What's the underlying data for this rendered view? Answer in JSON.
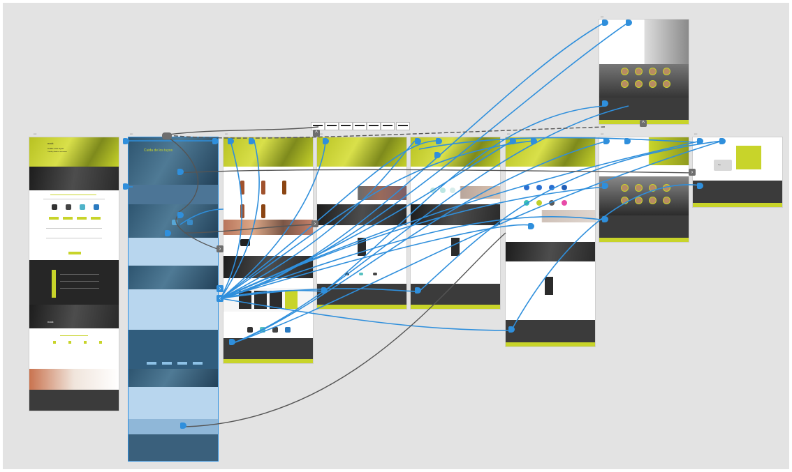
{
  "canvas": {
    "background": "#e3e3e3"
  },
  "colors": {
    "brand_lime": "#c8d42a",
    "link_blue": "#2f8fdc",
    "link_gray": "#555555",
    "footer_dark": "#3b3b3b"
  },
  "screens": {
    "home": {
      "logo_text": "nock",
      "hero_title": "Cuida a los tuyos",
      "hero_text": "Cuando y donde se encuentren"
    },
    "como": {
      "hero_title": "Cuida de los tuyos"
    },
    "contact": {
      "map_label": "Map"
    }
  },
  "icons": {
    "chevron_right": "›",
    "chevron_left": "‹",
    "chevron_up": "^"
  }
}
